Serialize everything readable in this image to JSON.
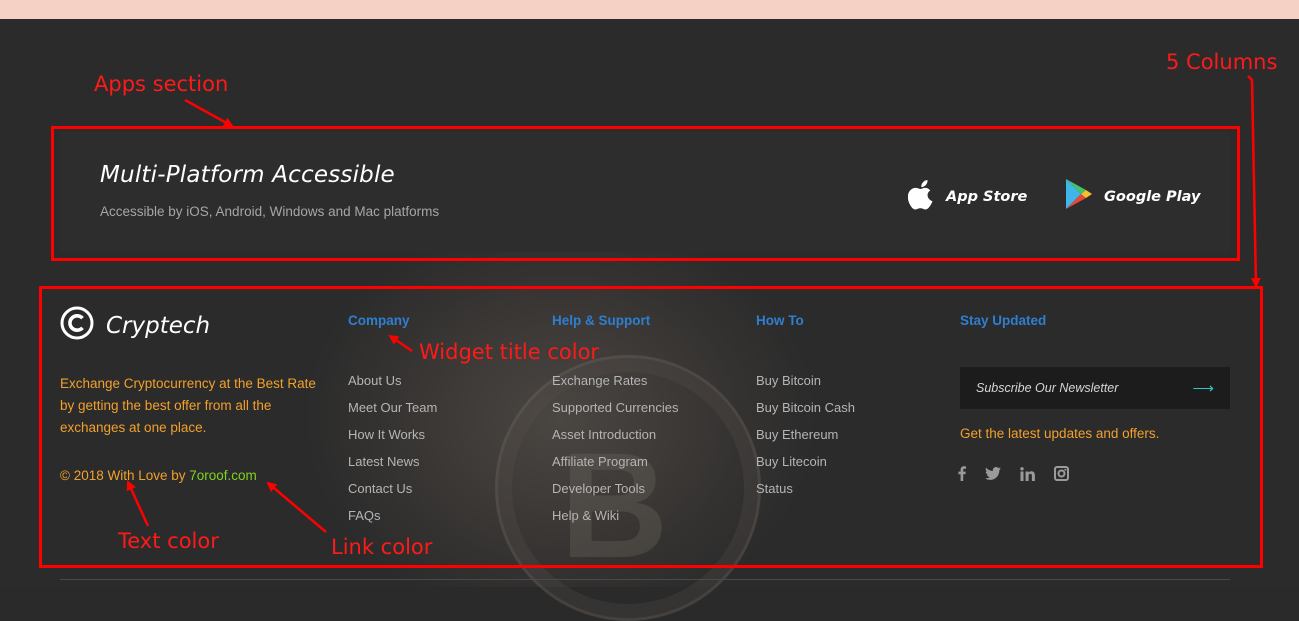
{
  "annotations": {
    "apps_section": "Apps section",
    "five_columns": "5 Columns",
    "widget_title_color": "Widget title color",
    "text_color": "Text color",
    "link_color": "Link color"
  },
  "apps": {
    "title": "Multi-Platform Accessible",
    "subtitle": "Accessible by iOS, Android, Windows and Mac platforms",
    "app_store": {
      "label": "App Store",
      "icon": "apple-icon"
    },
    "google_play": {
      "label": "Google Play",
      "icon": "google-play-icon"
    }
  },
  "brand": {
    "name": "Cryptech",
    "logo_icon": "copyright-c-icon",
    "description": "Exchange Cryptocurrency at the Best Rate by getting the best offer from all the exchanges at one place.",
    "copyright_prefix": "© 2018 With Love by ",
    "copyright_link": "7oroof.com"
  },
  "columns": [
    {
      "title": "Company",
      "links": [
        "About Us",
        "Meet Our Team",
        "How It Works",
        "Latest News",
        "Contact Us",
        "FAQs"
      ]
    },
    {
      "title": "Help & Support",
      "links": [
        "Exchange Rates",
        "Supported Currencies",
        "Asset Introduction",
        "Affiliate Program",
        "Developer Tools",
        "Help & Wiki"
      ]
    },
    {
      "title": "How To",
      "links": [
        "Buy Bitcoin",
        "Buy Bitcoin Cash",
        "Buy Ethereum",
        "Buy Litecoin",
        "Status"
      ]
    }
  ],
  "newsletter": {
    "title": "Stay Updated",
    "placeholder": "Subscribe Our Newsletter",
    "submit_icon": "arrow-right-icon",
    "note": "Get the latest updates and offers."
  },
  "social": [
    "facebook-icon",
    "twitter-icon",
    "linkedin-icon",
    "instagram-icon"
  ],
  "colors": {
    "widget_title": "#2f7fd0",
    "text": "#f2a02c",
    "link": "#7ed320",
    "annotation": "#ff0000",
    "top_bar": "#f5d0c4"
  }
}
